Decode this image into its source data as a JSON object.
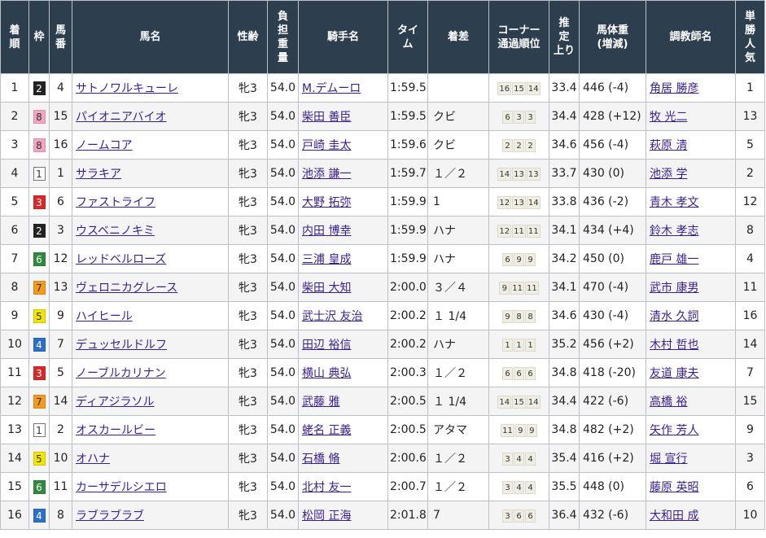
{
  "headers": {
    "rank": [
      "着",
      "順"
    ],
    "waku": "枠",
    "umaban": [
      "馬",
      "番"
    ],
    "horse": "馬名",
    "sexage": "性齢",
    "weight": [
      "負",
      "担",
      "重",
      "量"
    ],
    "jockey": "騎手名",
    "time": [
      "タイ",
      "ム"
    ],
    "margin": "着差",
    "corner": [
      "コーナー",
      "通過順位"
    ],
    "last3f": [
      "推",
      "定",
      "上り"
    ],
    "bodyweight": [
      "馬体重",
      "(増減)"
    ],
    "trainer": "調教師名",
    "popularity": [
      "単",
      "勝",
      "人",
      "気"
    ]
  },
  "colors": {
    "header_bg": "#2d3e4e",
    "link": "#3b1f8a",
    "waku_1": "#ffffff",
    "waku_2": "#222222",
    "waku_3": "#d42a2a",
    "waku_4": "#2a70c9",
    "waku_5": "#f2e600",
    "waku_6": "#2f8a3c",
    "waku_7": "#f39a1e",
    "waku_8": "#f2a5c0"
  },
  "rows": [
    {
      "rank": "1",
      "waku": "2",
      "umaban": "4",
      "horse": "サトノワルキューレ",
      "sexage": "牝3",
      "weight": "54.0",
      "jockey": "M.デムーロ",
      "time": "1:59.5",
      "margin": "",
      "corner": [
        "16",
        "15",
        "14"
      ],
      "last3f": "33.4",
      "bodyweight": "446 (-4)",
      "trainer": "角居 勝彦",
      "popularity": "1"
    },
    {
      "rank": "2",
      "waku": "8",
      "umaban": "15",
      "horse": "パイオニアバイオ",
      "sexage": "牝3",
      "weight": "54.0",
      "jockey": "柴田 善臣",
      "time": "1:59.5",
      "margin": "クビ",
      "corner": [
        "6",
        "3",
        "3"
      ],
      "last3f": "34.4",
      "bodyweight": "428 (+12)",
      "trainer": "牧 光二",
      "popularity": "13"
    },
    {
      "rank": "3",
      "waku": "8",
      "umaban": "16",
      "horse": "ノームコア",
      "sexage": "牝3",
      "weight": "54.0",
      "jockey": "戸崎 圭太",
      "time": "1:59.6",
      "margin": "クビ",
      "corner": [
        "2",
        "2",
        "2"
      ],
      "last3f": "34.6",
      "bodyweight": "456 (-4)",
      "trainer": "萩原 清",
      "popularity": "5"
    },
    {
      "rank": "4",
      "waku": "1",
      "umaban": "1",
      "horse": "サラキア",
      "sexage": "牝3",
      "weight": "54.0",
      "jockey": "池添 謙一",
      "time": "1:59.7",
      "margin": "１／２",
      "corner": [
        "14",
        "13",
        "13"
      ],
      "last3f": "33.7",
      "bodyweight": "430 (0)",
      "trainer": "池添 学",
      "popularity": "2"
    },
    {
      "rank": "5",
      "waku": "3",
      "umaban": "6",
      "horse": "ファストライフ",
      "sexage": "牝3",
      "weight": "54.0",
      "jockey": "大野 拓弥",
      "time": "1:59.9",
      "margin": "1",
      "corner": [
        "12",
        "13",
        "14"
      ],
      "last3f": "33.8",
      "bodyweight": "436 (-2)",
      "trainer": "青木 孝文",
      "popularity": "12"
    },
    {
      "rank": "6",
      "waku": "2",
      "umaban": "3",
      "horse": "ウスベニノキミ",
      "sexage": "牝3",
      "weight": "54.0",
      "jockey": "内田 博幸",
      "time": "1:59.9",
      "margin": "ハナ",
      "corner": [
        "12",
        "11",
        "11"
      ],
      "last3f": "34.1",
      "bodyweight": "434 (+4)",
      "trainer": "鈴木 孝志",
      "popularity": "8"
    },
    {
      "rank": "7",
      "waku": "6",
      "umaban": "12",
      "horse": "レッドベルローズ",
      "sexage": "牝3",
      "weight": "54.0",
      "jockey": "三浦 皇成",
      "time": "1:59.9",
      "margin": "ハナ",
      "corner": [
        "6",
        "9",
        "9"
      ],
      "last3f": "34.2",
      "bodyweight": "450 (0)",
      "trainer": "鹿戸 雄一",
      "popularity": "4"
    },
    {
      "rank": "8",
      "waku": "7",
      "umaban": "13",
      "horse": "ヴェロニカグレース",
      "sexage": "牝3",
      "weight": "54.0",
      "jockey": "柴田 大知",
      "time": "2:00.0",
      "margin": "３／４",
      "corner": [
        "9",
        "11",
        "11"
      ],
      "last3f": "34.1",
      "bodyweight": "470 (-4)",
      "trainer": "武市 康男",
      "popularity": "11"
    },
    {
      "rank": "9",
      "waku": "5",
      "umaban": "9",
      "horse": "ハイヒール",
      "sexage": "牝3",
      "weight": "54.0",
      "jockey": "武士沢 友治",
      "time": "2:00.2",
      "margin": "１ 1/4",
      "corner": [
        "9",
        "8",
        "8"
      ],
      "last3f": "34.6",
      "bodyweight": "430 (-4)",
      "trainer": "清水 久詞",
      "popularity": "16"
    },
    {
      "rank": "10",
      "waku": "4",
      "umaban": "7",
      "horse": "デュッセルドルフ",
      "sexage": "牝3",
      "weight": "54.0",
      "jockey": "田辺 裕信",
      "time": "2:00.2",
      "margin": "ハナ",
      "corner": [
        "1",
        "1",
        "1"
      ],
      "last3f": "35.2",
      "bodyweight": "456 (+2)",
      "trainer": "木村 哲也",
      "popularity": "14"
    },
    {
      "rank": "11",
      "waku": "3",
      "umaban": "5",
      "horse": "ノーブルカリナン",
      "sexage": "牝3",
      "weight": "54.0",
      "jockey": "横山 典弘",
      "time": "2:00.3",
      "margin": "１／２",
      "corner": [
        "6",
        "6",
        "6"
      ],
      "last3f": "34.8",
      "bodyweight": "418 (-20)",
      "trainer": "友道 康夫",
      "popularity": "7"
    },
    {
      "rank": "12",
      "waku": "7",
      "umaban": "14",
      "horse": "ディアジラソル",
      "sexage": "牝3",
      "weight": "54.0",
      "jockey": "武藤 雅",
      "time": "2:00.5",
      "margin": "１ 1/4",
      "corner": [
        "14",
        "15",
        "14"
      ],
      "last3f": "34.4",
      "bodyweight": "422 (-6)",
      "trainer": "高橋 裕",
      "popularity": "15"
    },
    {
      "rank": "13",
      "waku": "1",
      "umaban": "2",
      "horse": "オスカールビー",
      "sexage": "牝3",
      "weight": "54.0",
      "jockey": "蛯名 正義",
      "time": "2:00.5",
      "margin": "アタマ",
      "corner": [
        "11",
        "9",
        "9"
      ],
      "last3f": "34.8",
      "bodyweight": "482 (+2)",
      "trainer": "矢作 芳人",
      "popularity": "9"
    },
    {
      "rank": "14",
      "waku": "5",
      "umaban": "10",
      "horse": "オハナ",
      "sexage": "牝3",
      "weight": "54.0",
      "jockey": "石橋 脩",
      "time": "2:00.6",
      "margin": "１／２",
      "corner": [
        "3",
        "4",
        "4"
      ],
      "last3f": "35.4",
      "bodyweight": "416 (+2)",
      "trainer": "堀 宣行",
      "popularity": "3"
    },
    {
      "rank": "15",
      "waku": "6",
      "umaban": "11",
      "horse": "カーサデルシエロ",
      "sexage": "牝3",
      "weight": "54.0",
      "jockey": "北村 友一",
      "time": "2:00.7",
      "margin": "１／２",
      "corner": [
        "3",
        "4",
        "4"
      ],
      "last3f": "35.5",
      "bodyweight": "448 (0)",
      "trainer": "藤原 英昭",
      "popularity": "6"
    },
    {
      "rank": "16",
      "waku": "4",
      "umaban": "8",
      "horse": "ラブラブラブ",
      "sexage": "牝3",
      "weight": "54.0",
      "jockey": "松岡 正海",
      "time": "2:01.8",
      "margin": "7",
      "corner": [
        "3",
        "6",
        "6"
      ],
      "last3f": "36.4",
      "bodyweight": "432 (-6)",
      "trainer": "大和田 成",
      "popularity": "10"
    }
  ]
}
